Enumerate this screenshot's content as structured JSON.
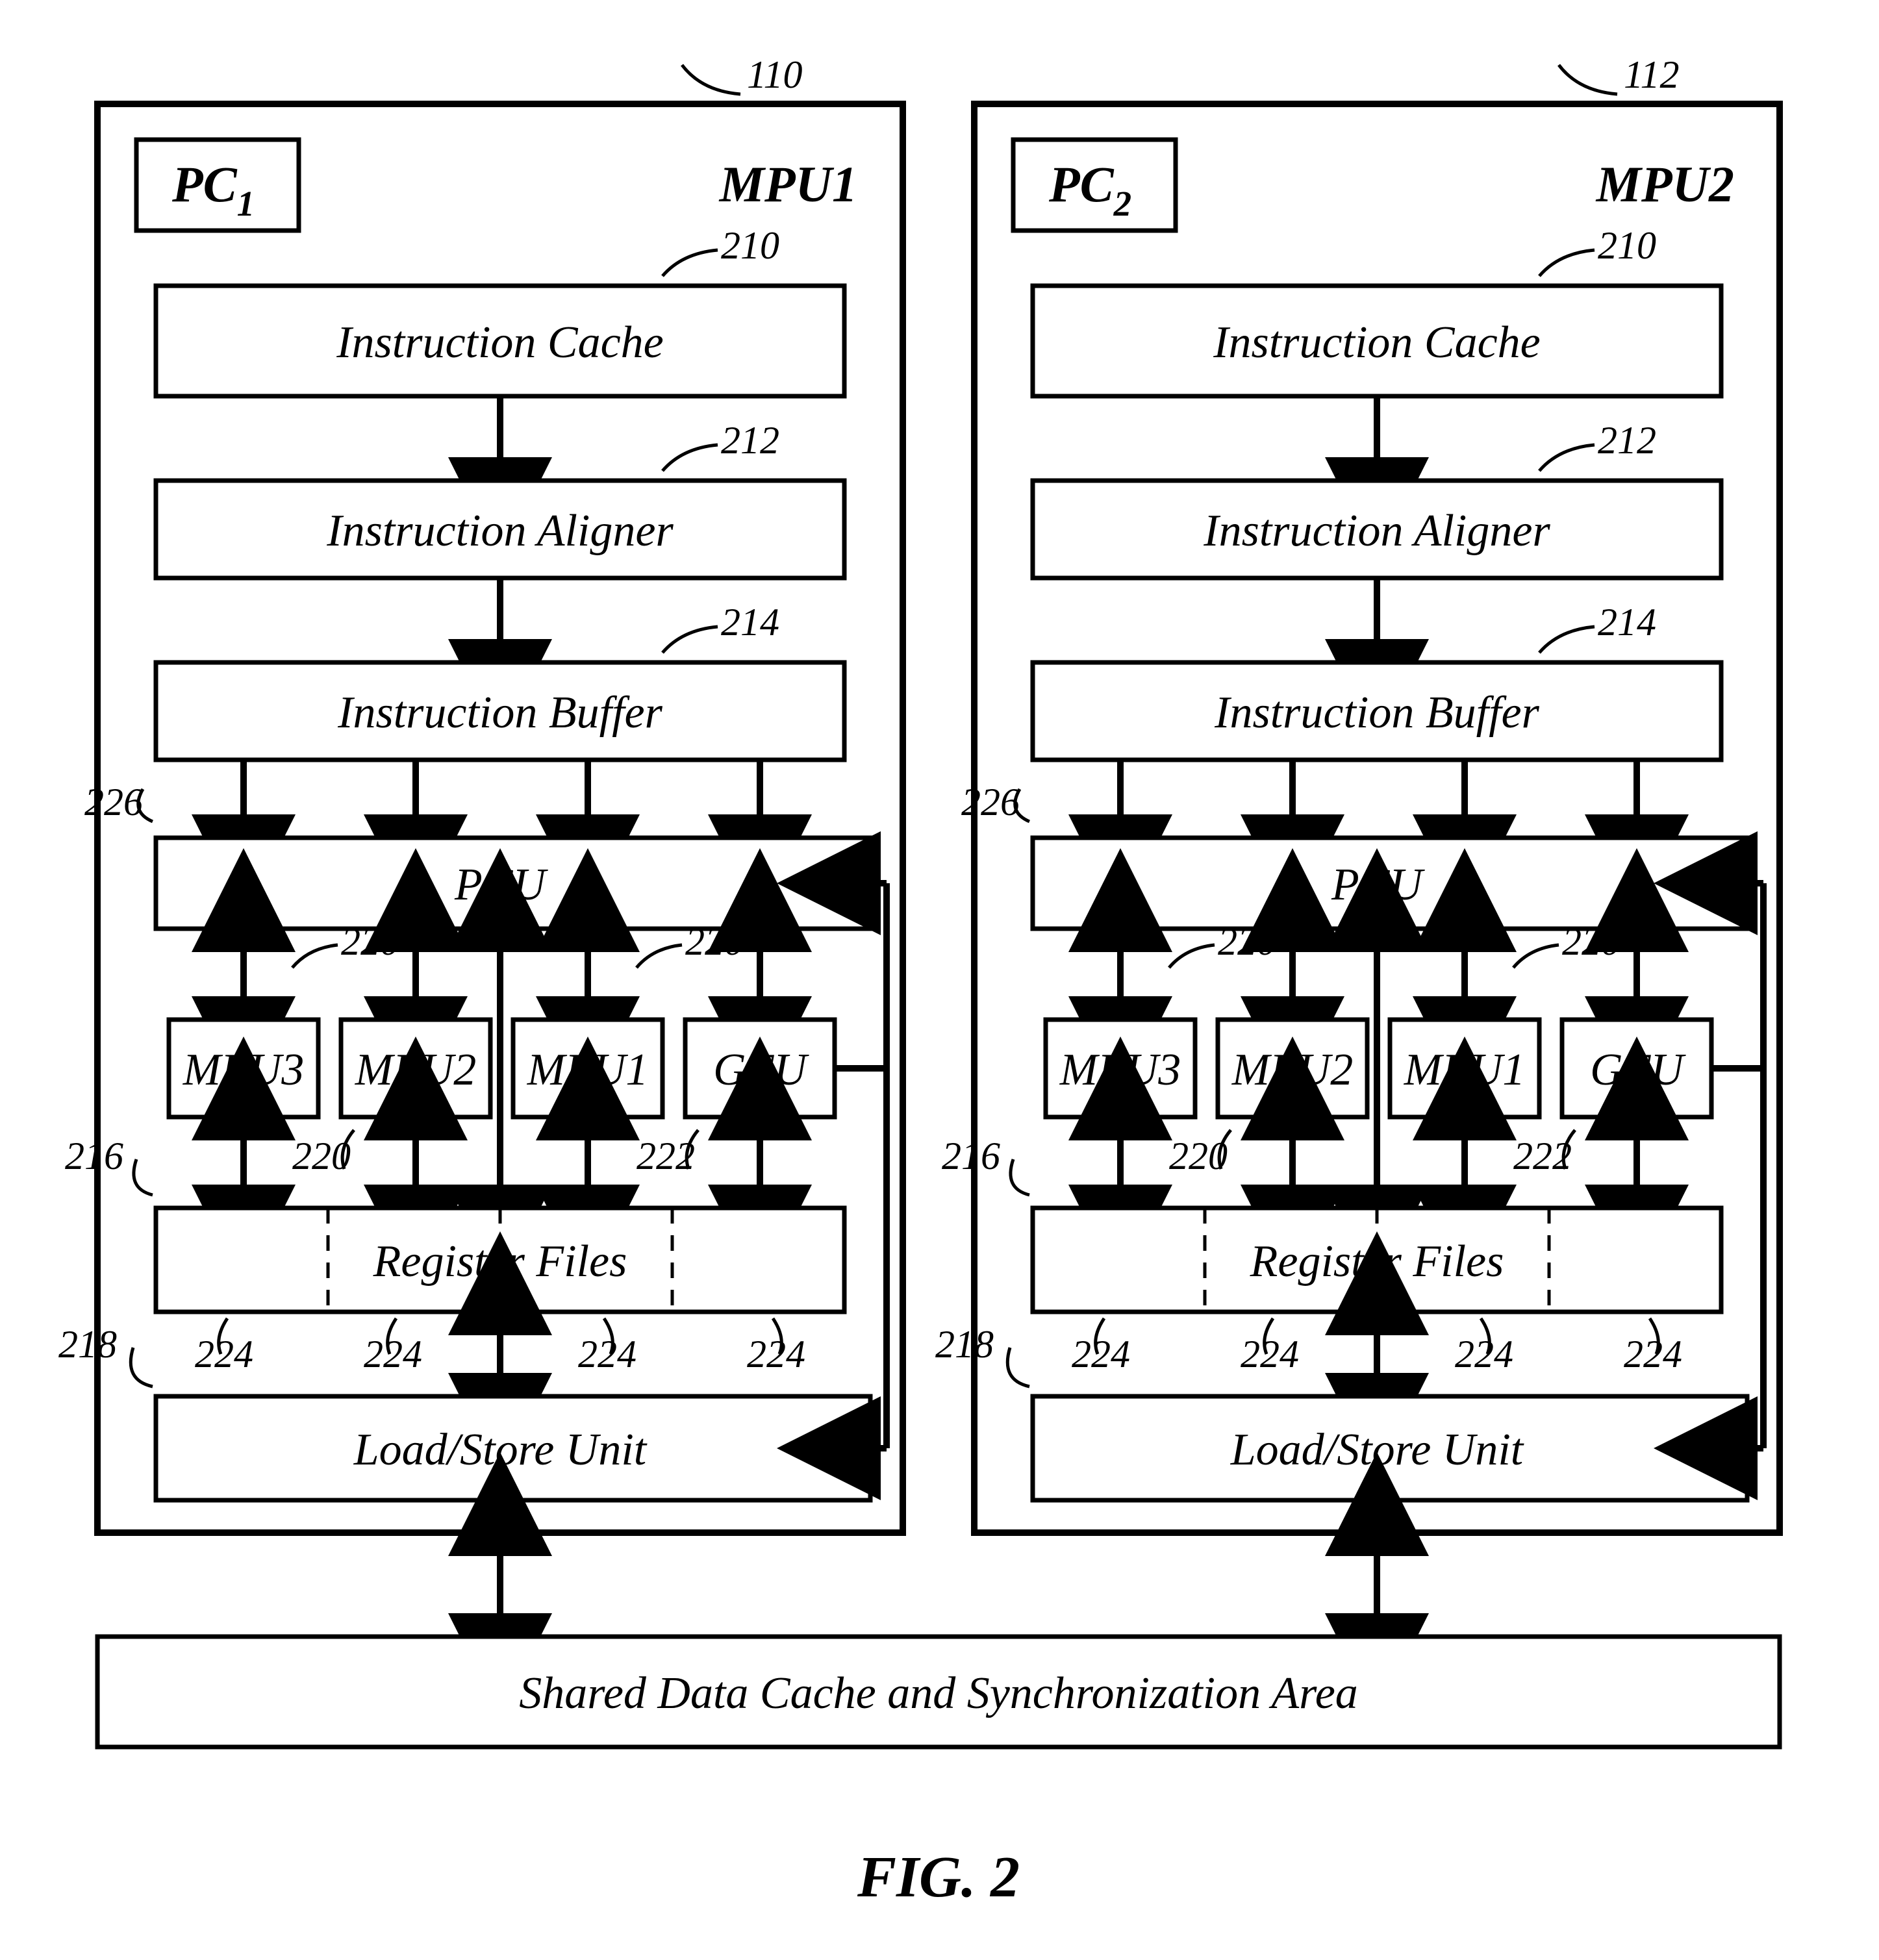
{
  "figureCaption": "FIG. 2",
  "mpu1": {
    "title": "MPU1",
    "pc": "PC",
    "pcSub": "1",
    "outerRef": "110",
    "blocks": {
      "icache": {
        "text": "Instruction Cache",
        "ref": "210"
      },
      "aligner": {
        "text": "Instruction Aligner",
        "ref": "212"
      },
      "ibuffer": {
        "text": "Instruction Buffer",
        "ref": "214"
      },
      "pcu": {
        "text": "PCU",
        "ref": "226"
      },
      "mfu3": {
        "text": "MFU3",
        "ref": "220"
      },
      "mfu2": {
        "text": "MFU2",
        "ref": "220"
      },
      "mfu1": {
        "text": "MFU1",
        "ref": "220"
      },
      "gfu": {
        "text": "GFU",
        "ref": "222"
      },
      "regfiles": {
        "text": "Register Files",
        "ref": "216",
        "segRef": "224"
      },
      "lsu": {
        "text": "Load/Store Unit",
        "ref": "218"
      }
    }
  },
  "mpu2": {
    "title": "MPU2",
    "pc": "PC",
    "pcSub": "2",
    "outerRef": "112",
    "blocks": {
      "icache": {
        "text": "Instruction Cache",
        "ref": "210"
      },
      "aligner": {
        "text": "Instruction Aligner",
        "ref": "212"
      },
      "ibuffer": {
        "text": "Instruction Buffer",
        "ref": "214"
      },
      "pcu": {
        "text": "PCU",
        "ref": "226"
      },
      "mfu3": {
        "text": "MFU3",
        "ref": "220"
      },
      "mfu2": {
        "text": "MFU2",
        "ref": "220"
      },
      "mfu1": {
        "text": "MFU1",
        "ref": "220"
      },
      "gfu": {
        "text": "GFU",
        "ref": "222"
      },
      "regfiles": {
        "text": "Register Files",
        "ref": "216",
        "segRef": "224"
      },
      "lsu": {
        "text": "Load/Store Unit",
        "ref": "218"
      }
    }
  },
  "shared": {
    "text": "Shared Data Cache and Synchronization Area"
  }
}
